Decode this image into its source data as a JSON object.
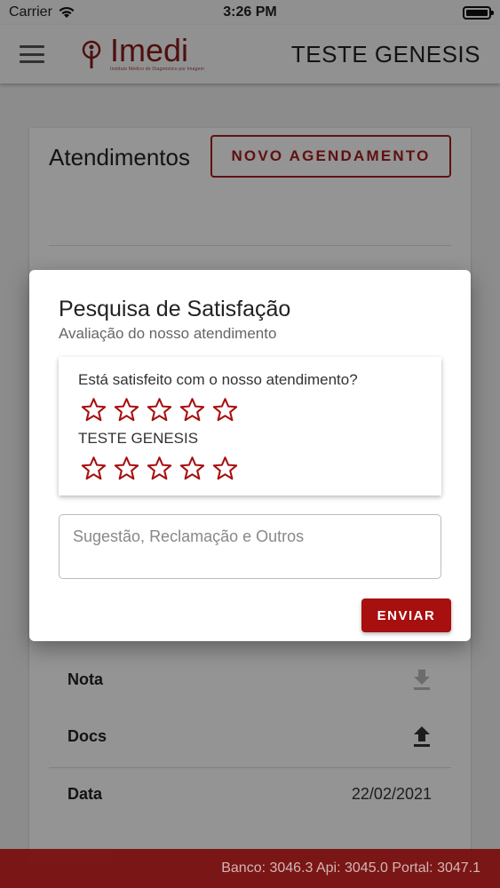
{
  "status_bar": {
    "carrier": "Carrier",
    "time": "3:26 PM"
  },
  "header": {
    "logo_text": "Imedi",
    "logo_tagline": "Instituto Médico de Diagnóstico por Imagem",
    "title": "TESTE GENESIS"
  },
  "page": {
    "title": "Atendimentos",
    "new_button": "NOVO AGENDAMENTO",
    "rows": [
      {
        "label": "Nota"
      },
      {
        "label": "Docs"
      },
      {
        "label": "Data",
        "value": "22/02/2021"
      }
    ]
  },
  "dialog": {
    "title": "Pesquisa de Satisfação",
    "subtitle": "Avaliação do nosso atendimento",
    "questions": [
      {
        "label": "Está satisfeito com o nosso atendimento?",
        "stars": 0,
        "max": 5
      },
      {
        "label": "TESTE GENESIS",
        "stars": 0,
        "max": 5
      }
    ],
    "comment_placeholder": "Sugestão, Reclamação e Outros",
    "send_button": "ENVIAR"
  },
  "footer": {
    "versions": "Banco: 3046.3 Api: 3045.0 Portal: 3047.1"
  },
  "colors": {
    "brand": "#a80f0f",
    "footer": "#7a1010"
  }
}
